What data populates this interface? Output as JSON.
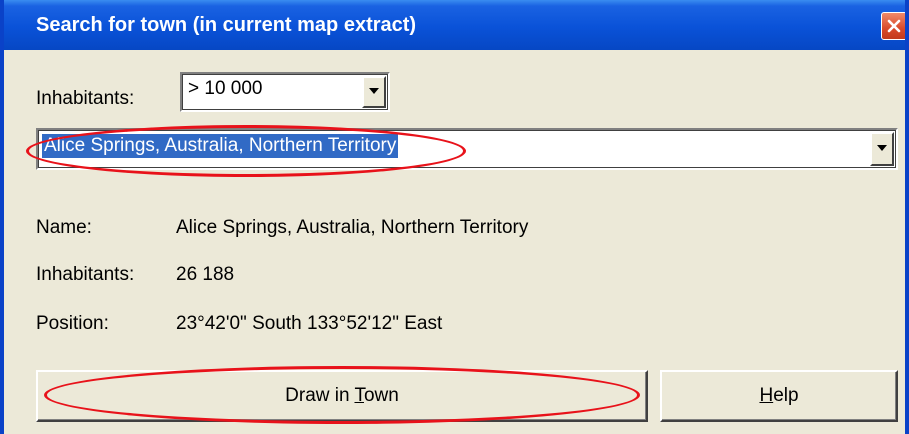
{
  "window": {
    "title": "Search for town (in current map extract)"
  },
  "filter": {
    "label": "Inhabitants:",
    "selected": "> 10 000"
  },
  "town_select": {
    "selected": "Alice Springs, Australia, Northern Territory"
  },
  "details": {
    "name_label": "Name:",
    "name_value": "Alice Springs, Australia, Northern Territory",
    "inhabitants_label": "Inhabitants:",
    "inhabitants_value": "26 188",
    "position_label": "Position:",
    "position_value": "23°42'0\" South   133°52'12\" East"
  },
  "buttons": {
    "draw_prefix": "Draw in ",
    "draw_accel": "T",
    "draw_suffix": "own",
    "help_accel": "H",
    "help_suffix": "elp"
  },
  "colors": {
    "titlebar": "#0a52d8",
    "selection": "#316ac5",
    "annotation": "#e8121a",
    "dialog_bg": "#ece9d8"
  },
  "icons": {
    "close": "close-icon",
    "dropdown": "chevron-down-icon"
  }
}
